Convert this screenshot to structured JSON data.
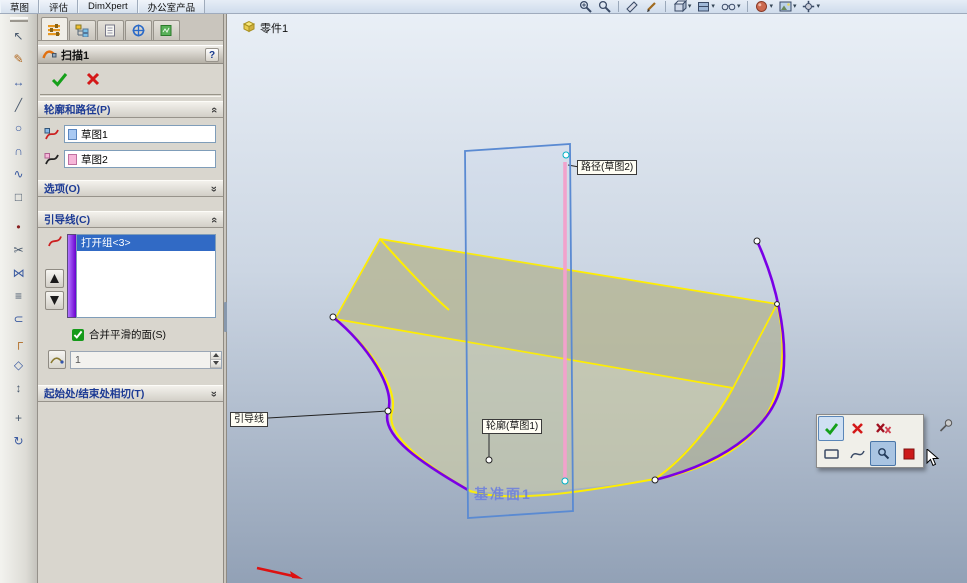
{
  "menubar": {
    "tabs": [
      "草图",
      "评估",
      "DimXpert",
      "办公室产品"
    ]
  },
  "top_view_icons": [
    "zoom-in",
    "zoom-fit",
    "section-view",
    "sketch-pencil",
    "view-orientation",
    "display-style",
    "hide-show-items",
    "edit-appearance",
    "apply-scene",
    "view-settings"
  ],
  "sidebar_tools": [
    {
      "name": "select-arrow-icon",
      "glyph": "↖",
      "color": "#4a5a6e"
    },
    {
      "name": "sketch-pencil-icon",
      "glyph": "✎",
      "color": "#b06820"
    },
    {
      "name": "smart-dimension-icon",
      "glyph": "↔",
      "color": "#3a5aa0"
    },
    {
      "name": "line-icon",
      "glyph": "╱",
      "color": "#4a5a6e"
    },
    {
      "name": "circle-icon",
      "glyph": "○",
      "color": "#3a5aa0"
    },
    {
      "name": "arc-icon",
      "glyph": "∩",
      "color": "#3a5aa0"
    },
    {
      "name": "spline-icon",
      "glyph": "∿",
      "color": "#3a5aa0"
    },
    {
      "name": "rectangle-icon",
      "glyph": "□",
      "color": "#4a5a6e"
    },
    {
      "name": "point-icon",
      "glyph": "•",
      "color": "#882020"
    },
    {
      "name": "trim-icon",
      "glyph": "✂",
      "color": "#4a5a6e"
    },
    {
      "name": "mirror-icon",
      "glyph": "⋈",
      "color": "#3a5aa0"
    },
    {
      "name": "offset-icon",
      "glyph": "≡",
      "color": "#4a5a6e"
    },
    {
      "name": "convert-entities-icon",
      "glyph": "⊂",
      "color": "#3a5aa0"
    },
    {
      "name": "fillet-icon",
      "glyph": "┌",
      "color": "#b06820"
    },
    {
      "name": "plane-icon",
      "glyph": "◇",
      "color": "#3a5aa0"
    },
    {
      "name": "axis-icon",
      "glyph": "↕",
      "color": "#4a5a6e"
    },
    {
      "name": "move-icon",
      "glyph": "+",
      "color": "#4a5a6e"
    },
    {
      "name": "rotate-view-icon",
      "glyph": "↻",
      "color": "#3a5aa0"
    }
  ],
  "property_manager": {
    "tabs": [
      "propertymanager-tab",
      "featuremanager-tab",
      "attributes-tab",
      "configurationmanager-tab",
      "displaymanager-tab"
    ],
    "title": "扫描1",
    "help": "?",
    "sections": {
      "profile_path": {
        "label": "轮廓和路径(P)",
        "profile_value": "草图1",
        "path_value": "草图2"
      },
      "options": {
        "label": "选项(O)"
      },
      "guide": {
        "label": "引导线(C)",
        "selected_item": "打开组<3>",
        "merge_label": "合并平滑的面(S)",
        "value": "1"
      },
      "tangency": {
        "label": "起始处/结束处相切(T)"
      }
    }
  },
  "viewport": {
    "part_name": "零件1",
    "callouts": {
      "path": "路径(草图2)",
      "profile": "轮廓(草图1)",
      "guide": "引导线",
      "plane": "基准面1"
    }
  },
  "colors": {
    "selection_blue": "#316ac5",
    "guide_purple": "#7a00e6",
    "edge_yellow": "#ffee00",
    "path_pink": "#f2a2cc",
    "sketch_blue": "#5a8ad2"
  }
}
